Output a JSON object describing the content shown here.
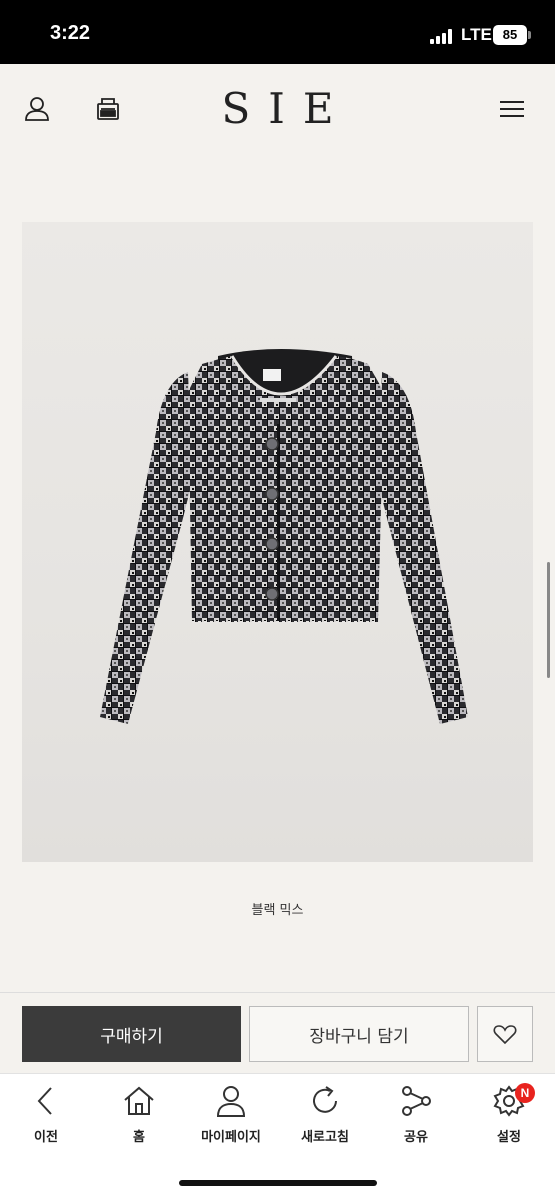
{
  "status_bar": {
    "time": "3:22",
    "network": "LTE",
    "battery": "85"
  },
  "header": {
    "logo": "SIE",
    "icons": [
      "user-icon",
      "cart-icon",
      "menu-icon"
    ]
  },
  "product": {
    "color_name": "블랙 믹스"
  },
  "purchase": {
    "buy_label": "구매하기",
    "cart_label": "장바구니 담기",
    "wish_icon": "heart-icon"
  },
  "bottom_nav": {
    "items": [
      {
        "label": "이전",
        "icon": "back-arrow-icon"
      },
      {
        "label": "홈",
        "icon": "home-icon"
      },
      {
        "label": "마이페이지",
        "icon": "person-icon"
      },
      {
        "label": "새로고침",
        "icon": "refresh-icon"
      },
      {
        "label": "공유",
        "icon": "share-icon"
      },
      {
        "label": "설정",
        "icon": "settings-icon",
        "badge": "N"
      }
    ]
  },
  "colors": {
    "buy_button": "#3b3b3b",
    "badge": "#e8231e",
    "background": "#f4f2ee"
  }
}
